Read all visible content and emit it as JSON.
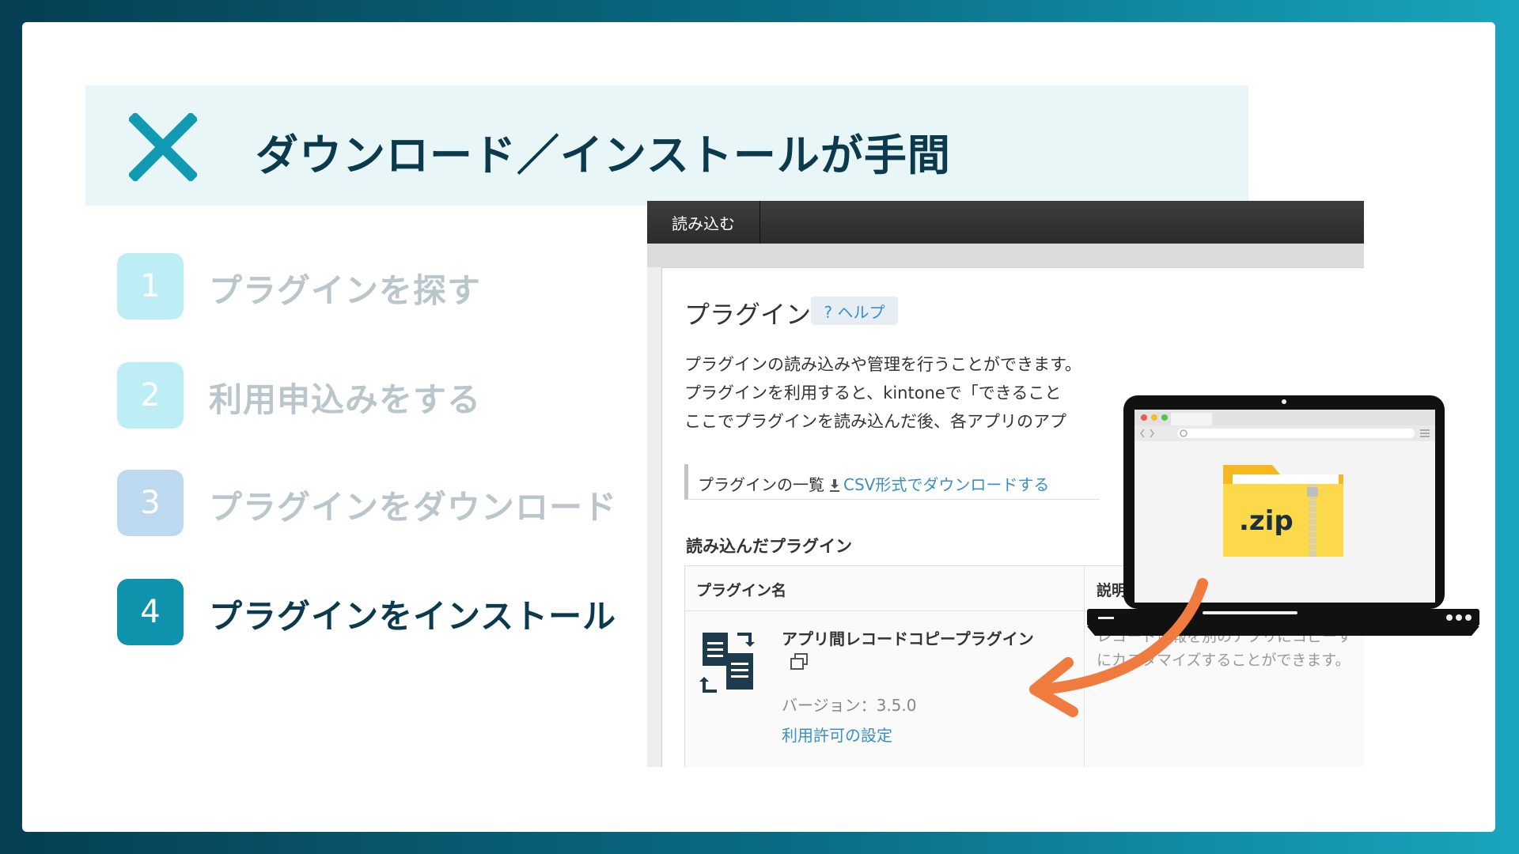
{
  "header": {
    "title": "ダウンロード／インストールが手間",
    "mark_icon": "x-mark-icon",
    "mark_color": "#119bb3"
  },
  "steps": [
    {
      "num": "1",
      "label": "プラグインを探す",
      "state": "done",
      "color": "#bdeef5"
    },
    {
      "num": "2",
      "label": "利用申込みをする",
      "state": "done",
      "color": "#bdeef5"
    },
    {
      "num": "3",
      "label": "プラグインをダウンロード",
      "state": "done",
      "color": "#bdd9ef"
    },
    {
      "num": "4",
      "label": "プラグインをインストール",
      "state": "active",
      "color": "#0f92ac"
    }
  ],
  "screenshot": {
    "tab": "読み込む",
    "title": "プラグイン",
    "help": "? ヘルプ",
    "desc": [
      "プラグインの読み込みや管理を行うことができます。",
      "プラグインを利用すると、kintoneで「できること",
      "ここでプラグインを読み込んだ後、各アプリのアプ"
    ],
    "list_label": "プラグインの一覧",
    "csv_link": "CSV形式でダウンロードする",
    "section_title": "読み込んだプラグイン",
    "col_name": "プラグイン名",
    "col_desc": "説明",
    "plugin": {
      "name": "アプリ間レコードコピープラグイン",
      "version": "バージョン：3.5.0",
      "permission_link": "利用許可の設定",
      "description": [
        "レコード情報を別のアプリにコピーす",
        "にカスタマイズすることができます。"
      ]
    }
  },
  "overlay": {
    "file_label": ".zip",
    "arrow_color": "#f07b3f"
  }
}
